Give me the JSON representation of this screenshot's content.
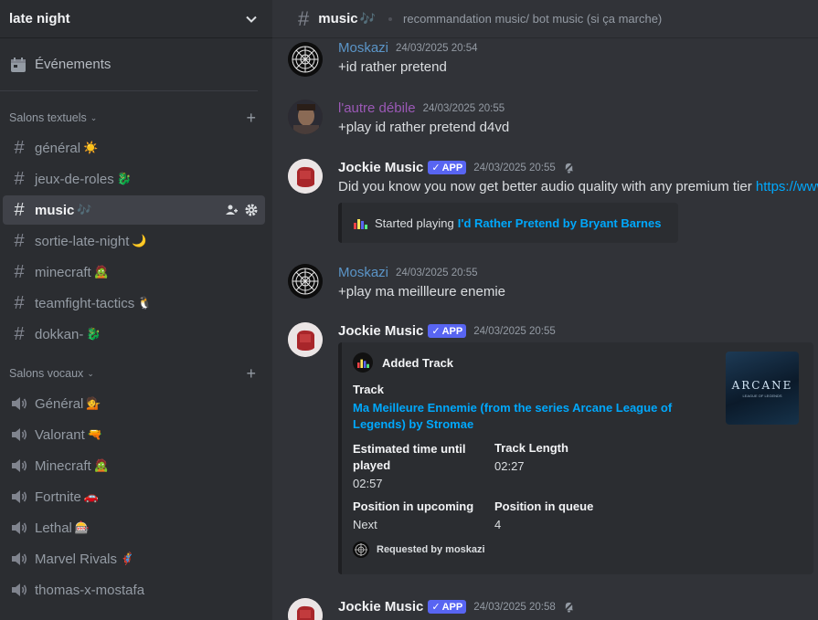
{
  "server": {
    "name": "late night"
  },
  "sidebar": {
    "events_label": "Événements",
    "text_category": "Salons textuels",
    "voice_category": "Salons vocaux",
    "text_channels": [
      {
        "name": "général",
        "emoji": "☀️"
      },
      {
        "name": "jeux-de-roles",
        "emoji": "🐉"
      },
      {
        "name": "music",
        "emoji": "🎶"
      },
      {
        "name": "sortie-late-night",
        "emoji": "🌙"
      },
      {
        "name": "minecraft",
        "emoji": "🧟"
      },
      {
        "name": "teamfight-tactics",
        "emoji": "🐧"
      },
      {
        "name": "dokkan-",
        "emoji": "🐉"
      }
    ],
    "voice_channels": [
      {
        "name": "Général",
        "emoji": "💁"
      },
      {
        "name": "Valorant",
        "emoji": "🔫"
      },
      {
        "name": "Minecraft",
        "emoji": "🧟"
      },
      {
        "name": "Fortnite",
        "emoji": "🚗"
      },
      {
        "name": "Lethal",
        "emoji": "🎰"
      },
      {
        "name": "Marvel Rivals",
        "emoji": "🦸"
      },
      {
        "name": "thomas-x-mostafa",
        "emoji": ""
      }
    ]
  },
  "topbar": {
    "channel": "music",
    "emoji": "🎶",
    "topic": "recommandation music/ bot music (si ça marche)"
  },
  "messages": [
    {
      "author": "Moskazi",
      "time": "24/03/2025 20:54",
      "text": "+id rather pretend"
    },
    {
      "author": "l'autre débile",
      "time": "24/03/2025 20:55",
      "text": "+play id rather pretend d4vd"
    },
    {
      "author": "Jockie Music",
      "badge": "APP",
      "time": "24/03/2025 20:55",
      "text": "Did you know you now get better audio quality with any premium tier ",
      "link": "https://www.jockiemusic.com",
      "embed_prefix": "Started playing",
      "embed_track": "I'd Rather Pretend by Bryant Barnes"
    },
    {
      "author": "Moskazi",
      "time": "24/03/2025 20:55",
      "text": "+play ma meillleure enemie"
    },
    {
      "author": "Jockie Music",
      "badge": "APP",
      "time": "24/03/2025 20:55"
    },
    {
      "author": "Jockie Music",
      "badge": "APP",
      "time": "24/03/2025 20:58"
    }
  ],
  "embed": {
    "title": "Added Track",
    "track_label": "Track",
    "track_value": "Ma Meilleure Ennemie (from the series Arcane League of Legends) by Stromae",
    "est_label": "Estimated time until played",
    "est_value": "02:57",
    "length_label": "Track Length",
    "length_value": "02:27",
    "pos_upcoming_label": "Position in upcoming",
    "pos_upcoming_value": "Next",
    "pos_queue_label": "Position in queue",
    "pos_queue_value": "4",
    "footer": "Requested by moskazi",
    "thumb_title": "ARCANE",
    "thumb_sub": "LEAGUE OF LEGENDS"
  }
}
